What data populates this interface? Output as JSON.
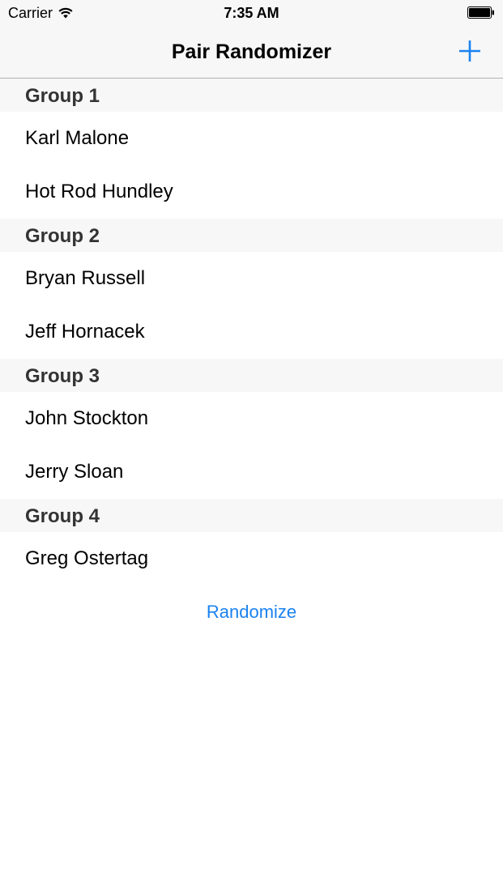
{
  "status_bar": {
    "carrier": "Carrier",
    "time": "7:35 AM"
  },
  "nav": {
    "title": "Pair Randomizer",
    "add_icon": "plus-icon"
  },
  "groups": [
    {
      "title": "Group 1",
      "members": [
        "Karl Malone",
        "Hot Rod Hundley"
      ]
    },
    {
      "title": "Group 2",
      "members": [
        "Bryan Russell",
        "Jeff Hornacek"
      ]
    },
    {
      "title": "Group 3",
      "members": [
        "John Stockton",
        "Jerry Sloan"
      ]
    },
    {
      "title": "Group 4",
      "members": [
        "Greg Ostertag"
      ]
    }
  ],
  "randomize_label": "Randomize",
  "colors": {
    "accent": "#1a82f0",
    "bar_background": "#f7f7f7",
    "section_text": "#333333"
  }
}
